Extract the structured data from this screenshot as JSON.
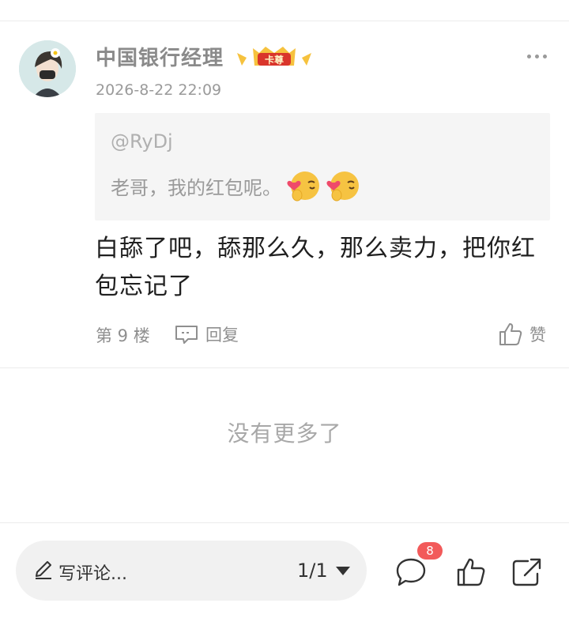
{
  "comment": {
    "username": "中国银行经理",
    "badge_label": "卡尊",
    "timestamp": "2026-8-22 22:09",
    "quote": {
      "user": "@RyDj",
      "text": "老哥，我的红包呢。",
      "emojis": [
        "heart-kiss-emoji",
        "heart-kiss-emoji"
      ]
    },
    "reply_text": "白舔了吧，舔那么久，那么卖力，把你红包忘记了",
    "floor_label": "第 9 楼",
    "reply_label": "回复",
    "like_label": "赞"
  },
  "end_message": "没有更多了",
  "bottom_bar": {
    "comment_placeholder": "写评论...",
    "page_indicator": "1/1",
    "comment_count": "8"
  },
  "colors": {
    "badge_red": "#d9352b",
    "badge_gold": "#f6c23e",
    "count_badge": "#f25a5a"
  }
}
